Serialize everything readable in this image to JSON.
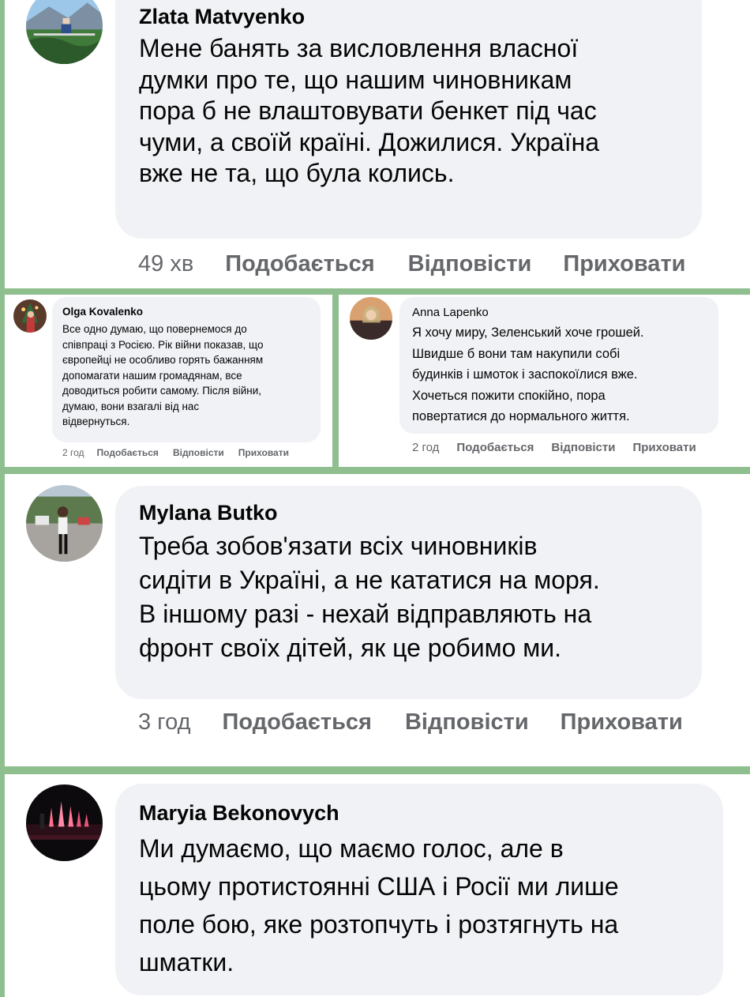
{
  "comments": [
    {
      "author": "Zlata Matvyenko",
      "avatar": "landscape-photo-avatar",
      "lines": [
        "Мене банять за висловлення власної",
        "думки про те, що нашим чиновникам",
        "пора б не влаштовувати бенкет під час",
        "чуми, а своїй країні. Дожилися. Україна",
        "вже не та, що була колись."
      ],
      "time": "49 хв",
      "like": "Подобається",
      "reply": "Відповісти",
      "hide": "Приховати"
    },
    {
      "author": "Olga Kovalenko",
      "avatar": "christmas-photo-avatar",
      "lines": [
        "Все одно думаю, що повернемося до",
        "співпраці з Росією. Рік війни показав, що",
        "європейці не особливо горять бажанням",
        "допомагати нашим громадянам, все",
        "доводиться робити самому. Після війни,",
        "думаю, вони взагалі від нас",
        "відвернуться."
      ],
      "time": "2 год",
      "like": "Подобається",
      "reply": "Відповісти",
      "hide": "Приховати"
    },
    {
      "author": "Anna Lapenko",
      "avatar": "portrait-photo-avatar",
      "lines": [
        "Я хочу миру, Зеленський хоче грошей.",
        "Швидше б вони там накупили собі",
        "будинків і шмоток і заспокоїлися вже.",
        "Хочеться пожити спокійно, пора",
        "повертатися до нормального життя."
      ],
      "time": "2 год",
      "like": "Подобається",
      "reply": "Відповісти",
      "hide": "Приховати"
    },
    {
      "author": "Mylana Butko",
      "avatar": "street-photo-avatar",
      "lines": [
        "Треба зобов'язати всіх чиновників",
        "сидіти в Україні, а не кататися на моря.",
        "В іншому разі - нехай відправляють на",
        "фронт своїх дітей, як це робимо ми."
      ],
      "time": "3 год",
      "like": "Подобається",
      "reply": "Відповісти",
      "hide": "Приховати"
    },
    {
      "author": "Maryia Bekonovych",
      "avatar": "night-fountain-photo-avatar",
      "lines": [
        "Ми думаємо, що маємо голос, але в",
        "цьому протистоянні США і Росії ми лише",
        "поле бою, яке розтопчуть і розтягнуть на",
        "шматки."
      ]
    }
  ]
}
